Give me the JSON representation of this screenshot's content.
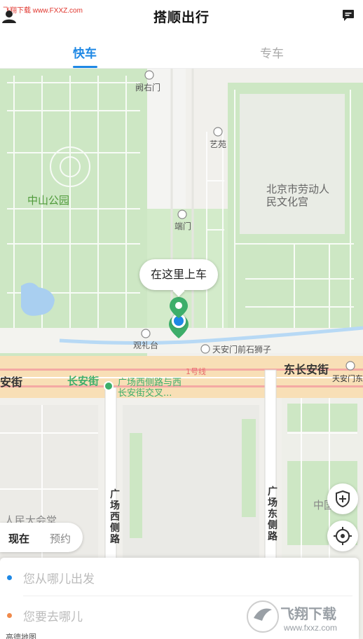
{
  "header": {
    "watermark": "飞翔下载 www.FXXZ.com",
    "title": "搭顺出行",
    "user_icon": "user-icon",
    "message_icon": "message-icon"
  },
  "tabs": [
    {
      "label": "快车",
      "active": true
    },
    {
      "label": "专车",
      "active": false
    }
  ],
  "map": {
    "labels": {
      "kuoyoumen": "阙右门",
      "yiyuan": "艺苑",
      "zhongshan_park": "中山公园",
      "workers_palace": "北京市劳动人民文化宫",
      "duanmen": "端门",
      "guanlitai": "观礼台",
      "lions": "天安门前石狮子",
      "changan_west": "安街",
      "changan_green": "长安街",
      "line1": "1号线",
      "east_changan": "东长安街",
      "tiananmen_east": "天安门东",
      "poi_junction": "广场西侧路与西长安街交叉...",
      "west_side_road": "广场西侧路",
      "east_side_road": "广场东侧路",
      "great_hall": "人民大会堂",
      "museum": "中国",
      "amap": "高德地图"
    },
    "pickup_bubble": "在这里上车"
  },
  "time_toggle": {
    "now": "现在",
    "later": "预约"
  },
  "controls": {
    "safety_icon": "shield-icon",
    "locate_icon": "locate-icon"
  },
  "trip": {
    "from_placeholder": "您从哪儿出发",
    "to_placeholder": "您要去哪儿"
  },
  "watermark_logo": {
    "main": "飞翔下载",
    "url": "www.fxxz.com"
  },
  "colors": {
    "accent": "#1e88e5",
    "map_green": "#c9e6bf",
    "pickup_pin": "#3dae6a"
  }
}
